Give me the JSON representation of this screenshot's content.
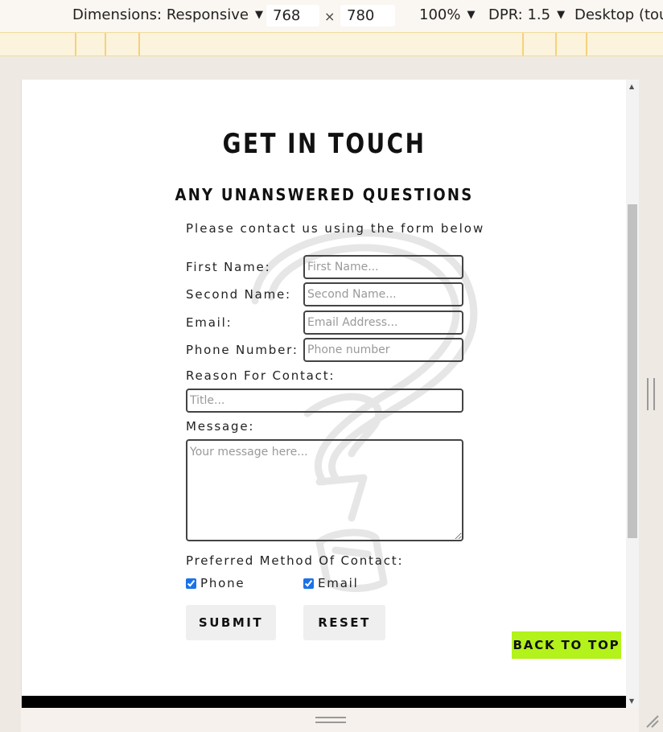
{
  "devtools": {
    "dimensions_label": "Dimensions: Responsive",
    "width_value": "768",
    "height_value": "780",
    "times_symbol": "×",
    "zoom": "100%",
    "dpr": "DPR: 1.5",
    "device_mode": "Desktop (touc",
    "caret": "▼"
  },
  "page": {
    "title": "GET IN TOUCH",
    "subtitle": "ANY UNANSWERED QUESTIONS",
    "intro": "Please contact us using the form below"
  },
  "form": {
    "first_name": {
      "label": "First Name:",
      "placeholder": "First Name..."
    },
    "second_name": {
      "label": "Second Name:",
      "placeholder": "Second Name..."
    },
    "email": {
      "label": "Email:",
      "placeholder": "Email Address..."
    },
    "phone": {
      "label": "Phone Number:",
      "placeholder": "Phone number"
    },
    "reason": {
      "label": "Reason For Contact:",
      "placeholder": "Title..."
    },
    "message": {
      "label": "Message:",
      "placeholder": "Your message here..."
    },
    "preferred": {
      "label": "Preferred Method Of Contact:",
      "options": [
        {
          "label": "Phone",
          "checked": true
        },
        {
          "label": "Email",
          "checked": true
        }
      ]
    },
    "submit_label": "SUBMIT",
    "reset_label": "RESET"
  },
  "back_to_top": {
    "label": "BACK TO TOP",
    "color": "#b3f21a"
  },
  "icons": {
    "watermark": "question-mark-sketch-icon",
    "scroll_up": "▲",
    "scroll_down": "▼"
  }
}
